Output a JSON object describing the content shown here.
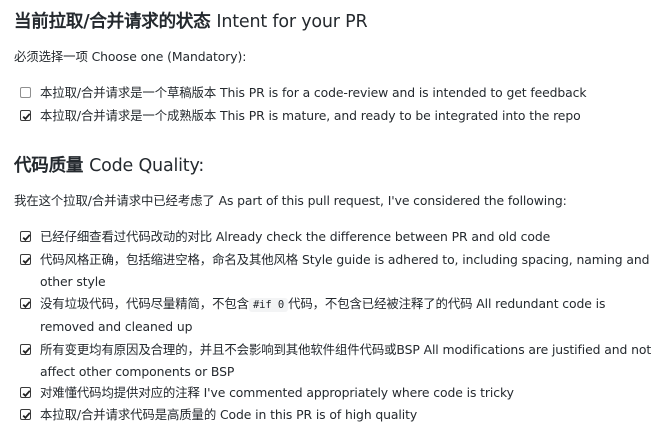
{
  "intent": {
    "title_zh": "当前拉取/合并请求的状态",
    "title_en": "Intent for your PR",
    "intro": "必须选择一项 Choose one (Mandatory):",
    "items": [
      {
        "label": "本拉取/合并请求是一个草稿版本 This PR is for a code-review and is intended to get feedback",
        "checked": false
      },
      {
        "label": "本拉取/合并请求是一个成熟版本 This PR is mature, and ready to be integrated into the repo",
        "checked": true
      }
    ]
  },
  "quality": {
    "title_zh": "代码质量",
    "title_en": "Code Quality:",
    "intro": "我在这个拉取/合并请求中已经考虑了 As part of this pull request, I've considered the following:",
    "items": [
      {
        "label": "已经仔细查看过代码改动的对比 Already check the difference between PR and old code",
        "checked": true
      },
      {
        "label": "代码风格正确，包括缩进空格，命名及其他风格 Style guide is adhered to, including spacing, naming and other style",
        "checked": true
      },
      {
        "label_before": "没有垃圾代码，代码尽量精简，不包含",
        "code": "#if 0",
        "label_after": "代码，不包含已经被注释了的代码 All redundant code is removed and cleaned up",
        "checked": true
      },
      {
        "label": "所有变更均有原因及合理的，并且不会影响到其他软件组件代码或BSP All modifications are justified and not affect other components or BSP",
        "checked": true
      },
      {
        "label": "对难懂代码均提供对应的注释 I've commented appropriately where code is tricky",
        "checked": true
      },
      {
        "label": "本拉取/合并请求代码是高质量的 Code in this PR is of high quality",
        "checked": true
      }
    ]
  }
}
